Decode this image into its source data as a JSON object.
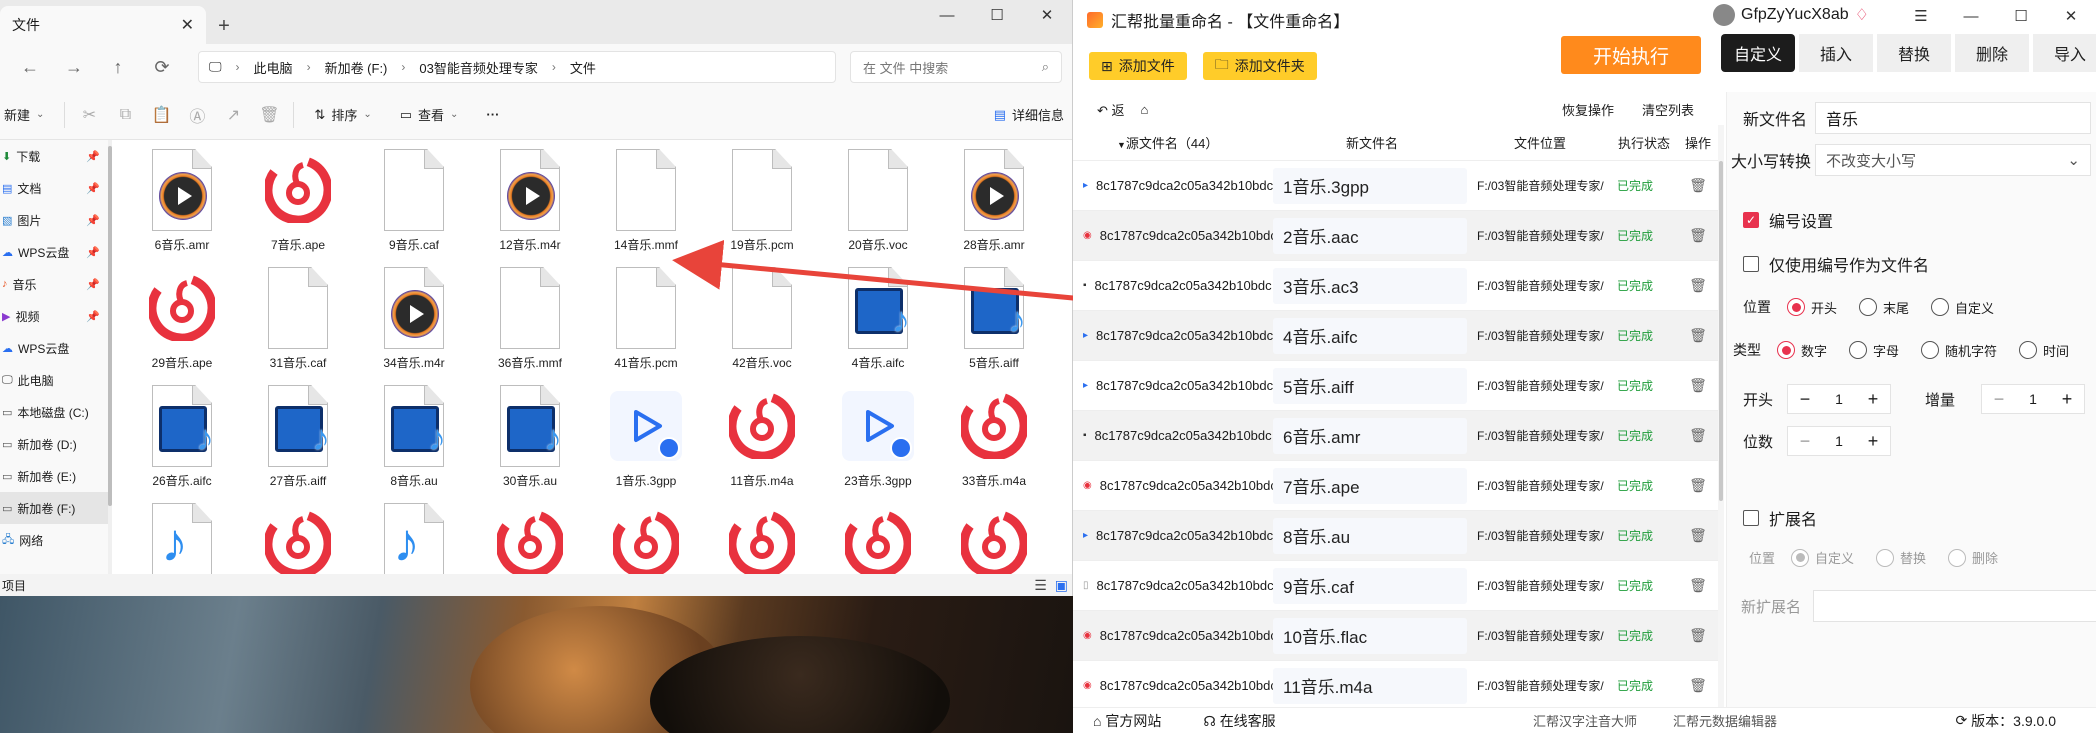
{
  "explorer": {
    "tab_title": "文件",
    "breadcrumb": [
      "此电脑",
      "新加卷 (F:)",
      "03智能音频处理专家",
      "文件"
    ],
    "search_placeholder": "在 文件 中搜索",
    "toolbar": {
      "new_label": "新建",
      "sort_label": "排序",
      "view_label": "查看",
      "more_label": "···",
      "details_label": "详细信息"
    },
    "sidebar": [
      {
        "label": "下载",
        "pinned": true
      },
      {
        "label": "文档",
        "pinned": true
      },
      {
        "label": "图片",
        "pinned": true
      },
      {
        "label": "WPS云盘",
        "pinned": true
      },
      {
        "label": "音乐",
        "pinned": true
      },
      {
        "label": "视频",
        "pinned": true
      },
      {
        "label": "WPS云盘",
        "pinned": false
      },
      {
        "label": "此电脑",
        "pinned": false
      },
      {
        "label": "本地磁盘 (C:)",
        "pinned": false
      },
      {
        "label": "新加卷 (D:)",
        "pinned": false
      },
      {
        "label": "新加卷 (E:)",
        "pinned": false
      },
      {
        "label": "新加卷 (F:)",
        "pinned": false
      },
      {
        "label": "网络",
        "pinned": false
      }
    ],
    "files": [
      {
        "name": "6音乐.amr",
        "icon": "player-icon"
      },
      {
        "name": "7音乐.ape",
        "icon": "netease-icon"
      },
      {
        "name": "9音乐.caf",
        "icon": "blank-icon"
      },
      {
        "name": "12音乐.m4r",
        "icon": "player-icon"
      },
      {
        "name": "14音乐.mmf",
        "icon": "blank-icon"
      },
      {
        "name": "19音乐.pcm",
        "icon": "blank-icon"
      },
      {
        "name": "20音乐.voc",
        "icon": "blank-icon"
      },
      {
        "name": "28音乐.amr",
        "icon": "player-icon"
      },
      {
        "name": "29音乐.ape",
        "icon": "netease-icon"
      },
      {
        "name": "31音乐.caf",
        "icon": "blank-icon"
      },
      {
        "name": "34音乐.m4r",
        "icon": "player-icon"
      },
      {
        "name": "36音乐.mmf",
        "icon": "blank-icon"
      },
      {
        "name": "41音乐.pcm",
        "icon": "blank-icon"
      },
      {
        "name": "42音乐.voc",
        "icon": "blank-icon"
      },
      {
        "name": "4音乐.aifc",
        "icon": "media-icon"
      },
      {
        "name": "5音乐.aiff",
        "icon": "media-icon"
      },
      {
        "name": "26音乐.aifc",
        "icon": "media-icon"
      },
      {
        "name": "27音乐.aiff",
        "icon": "media-icon"
      },
      {
        "name": "8音乐.au",
        "icon": "media-icon"
      },
      {
        "name": "30音乐.au",
        "icon": "media-icon"
      },
      {
        "name": "1音乐.3gpp",
        "icon": "video-icon"
      },
      {
        "name": "11音乐.m4a",
        "icon": "netease-icon"
      },
      {
        "name": "23音乐.3gpp",
        "icon": "video-icon"
      },
      {
        "name": "33音乐.m4a",
        "icon": "netease-icon"
      },
      {
        "name": "",
        "icon": "mp3-icon"
      },
      {
        "name": "",
        "icon": "netease-icon"
      },
      {
        "name": "",
        "icon": "mp3-icon"
      },
      {
        "name": "",
        "icon": "netease-icon"
      },
      {
        "name": "",
        "icon": "netease-icon"
      },
      {
        "name": "",
        "icon": "netease-icon"
      },
      {
        "name": "",
        "icon": "netease-icon"
      },
      {
        "name": "",
        "icon": "netease-icon"
      }
    ],
    "status_text": "项目"
  },
  "app": {
    "title": "汇帮批量重命名 - 【文件重命名】",
    "username": "GfpZyYucX8ab",
    "add_file_label": "添加文件",
    "add_folder_label": "添加文件夹",
    "start_label": "开始执行",
    "tabs": [
      "自定义",
      "插入",
      "替换",
      "删除",
      "导入"
    ],
    "back_label": "返",
    "undo_label": "恢复操作",
    "clear_label": "清空列表",
    "columns": {
      "src": "源文件名（44）",
      "new": "新文件名",
      "loc": "文件位置",
      "status": "执行状态",
      "op": "操作"
    },
    "rows": [
      {
        "src": "8c1787c9dca2c05a342b10bdc",
        "new": "1音乐.3gpp",
        "loc": "F:/03智能音频处理专家/",
        "status": "已完成"
      },
      {
        "src": "8c1787c9dca2c05a342b10bdc",
        "new": "2音乐.aac",
        "loc": "F:/03智能音频处理专家/",
        "status": "已完成"
      },
      {
        "src": "8c1787c9dca2c05a342b10bdc",
        "new": "3音乐.ac3",
        "loc": "F:/03智能音频处理专家/",
        "status": "已完成"
      },
      {
        "src": "8c1787c9dca2c05a342b10bdc",
        "new": "4音乐.aifc",
        "loc": "F:/03智能音频处理专家/",
        "status": "已完成"
      },
      {
        "src": "8c1787c9dca2c05a342b10bdc",
        "new": "5音乐.aiff",
        "loc": "F:/03智能音频处理专家/",
        "status": "已完成"
      },
      {
        "src": "8c1787c9dca2c05a342b10bdc",
        "new": "6音乐.amr",
        "loc": "F:/03智能音频处理专家/",
        "status": "已完成"
      },
      {
        "src": "8c1787c9dca2c05a342b10bdc",
        "new": "7音乐.ape",
        "loc": "F:/03智能音频处理专家/",
        "status": "已完成"
      },
      {
        "src": "8c1787c9dca2c05a342b10bdc",
        "new": "8音乐.au",
        "loc": "F:/03智能音频处理专家/",
        "status": "已完成"
      },
      {
        "src": "8c1787c9dca2c05a342b10bdc",
        "new": "9音乐.caf",
        "loc": "F:/03智能音频处理专家/",
        "status": "已完成"
      },
      {
        "src": "8c1787c9dca2c05a342b10bdc",
        "new": "10音乐.flac",
        "loc": "F:/03智能音频处理专家/",
        "status": "已完成"
      },
      {
        "src": "8c1787c9dca2c05a342b10bdc",
        "new": "11音乐.m4a",
        "loc": "F:/03智能音频处理专家/",
        "status": "已完成"
      }
    ],
    "panel": {
      "new_name_label": "新文件名",
      "new_name_value": "音乐",
      "case_label": "大小写转换",
      "case_value": "不改变大小写",
      "numbering_label": "编号设置",
      "only_number_label": "仅使用编号作为文件名",
      "position_label": "位置",
      "position_options": [
        "开头",
        "末尾",
        "自定义"
      ],
      "type_label": "类型",
      "type_options": [
        "数字",
        "字母",
        "随机字符",
        "时间"
      ],
      "start_label": "开头",
      "start_value": "1",
      "increment_label": "增量",
      "increment_value": "1",
      "digits_label": "位数",
      "digits_value": "1",
      "ext_label": "扩展名",
      "ext_position_label": "位置",
      "ext_options": [
        "自定义",
        "替换",
        "删除"
      ],
      "new_ext_label": "新扩展名"
    },
    "footer": {
      "site_label": "官方网站",
      "service_label": "在线客服",
      "link1": "汇帮汉字注音大师",
      "link2": "汇帮元数据编辑器",
      "version": "版本：3.9.0.0"
    },
    "colors": {
      "accent_yellow": "#ffcc29",
      "start_orange": "#ff8a1c",
      "check_red": "#e8324e",
      "done_green": "#1f9d3a"
    }
  }
}
